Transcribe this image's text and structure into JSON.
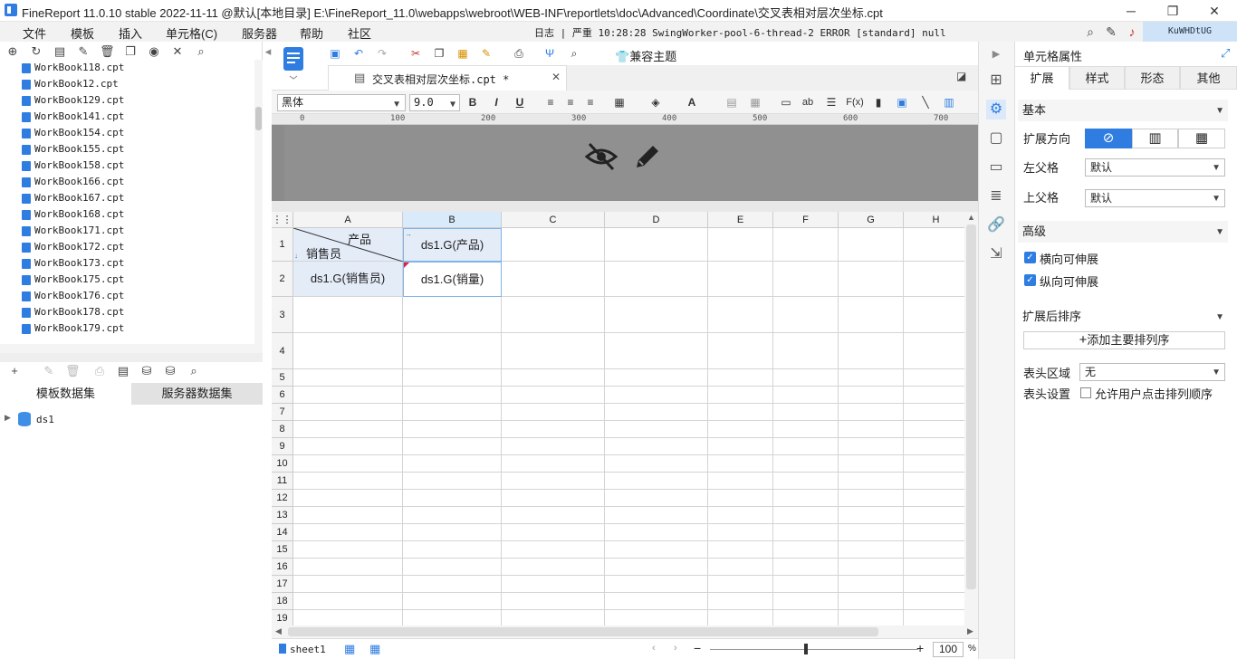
{
  "window": {
    "title": "FineReport 11.0.10 stable 2022-11-11 @默认[本地目录]    E:\\FineReport_11.0\\webapps\\webroot\\WEB-INF\\reportlets\\doc\\Advanced\\Coordinate\\交叉表相对层次坐标.cpt"
  },
  "menu": {
    "items": [
      "文件",
      "模板",
      "插入",
      "单元格(C)",
      "服务器",
      "帮助",
      "社区"
    ],
    "log": "日志 | 严重 10:28:28 SwingWorker-pool-6-thread-2 ERROR [standard] null",
    "user": "KuWHDtUG"
  },
  "files": [
    "WorkBook118.cpt",
    "WorkBook12.cpt",
    "WorkBook129.cpt",
    "WorkBook141.cpt",
    "WorkBook154.cpt",
    "WorkBook155.cpt",
    "WorkBook158.cpt",
    "WorkBook166.cpt",
    "WorkBook167.cpt",
    "WorkBook168.cpt",
    "WorkBook171.cpt",
    "WorkBook172.cpt",
    "WorkBook173.cpt",
    "WorkBook175.cpt",
    "WorkBook176.cpt",
    "WorkBook178.cpt",
    "WorkBook179.cpt"
  ],
  "dataset": {
    "tab_template": "模板数据集",
    "tab_server": "服务器数据集",
    "tree_item": "ds1"
  },
  "editor": {
    "doc_tab": "交叉表相对层次坐标.cpt *",
    "theme_label": "兼容主题",
    "font_name": "黑体",
    "font_size": "9.0",
    "ruler_labels": [
      "0",
      "100",
      "200",
      "300",
      "400",
      "500",
      "600",
      "700"
    ],
    "columns": [
      "A",
      "B",
      "C",
      "D",
      "E",
      "F",
      "G",
      "H"
    ],
    "rows": [
      "1",
      "2",
      "3",
      "4",
      "5",
      "6",
      "7",
      "8",
      "9",
      "10",
      "11",
      "12",
      "13",
      "14",
      "15",
      "16",
      "17",
      "18",
      "19"
    ],
    "cells": {
      "a1_top": "产品",
      "a1_bottom": "销售员",
      "b1": "ds1.G(产品)",
      "a2": "ds1.G(销售员)",
      "b2": "ds1.G(销量)"
    },
    "sheet": "sheet1",
    "zoom": "100",
    "zoom_unit": "%"
  },
  "props": {
    "title": "单元格属性",
    "tabs": [
      "扩展",
      "样式",
      "形态",
      "其他"
    ],
    "sec_basic": "基本",
    "expand_dir": "扩展方向",
    "left_parent": "左父格",
    "left_parent_val": "默认",
    "up_parent": "上父格",
    "up_parent_val": "默认",
    "sec_adv": "高级",
    "h_expand": "横向可伸展",
    "v_expand": "纵向可伸展",
    "sort_sec": "扩展后排序",
    "add_sort": "添加主要排列序",
    "header_region": "表头区域",
    "header_region_val": "无",
    "header_setting": "表头设置",
    "allow_sort": "允许用户点击排列顺序"
  }
}
